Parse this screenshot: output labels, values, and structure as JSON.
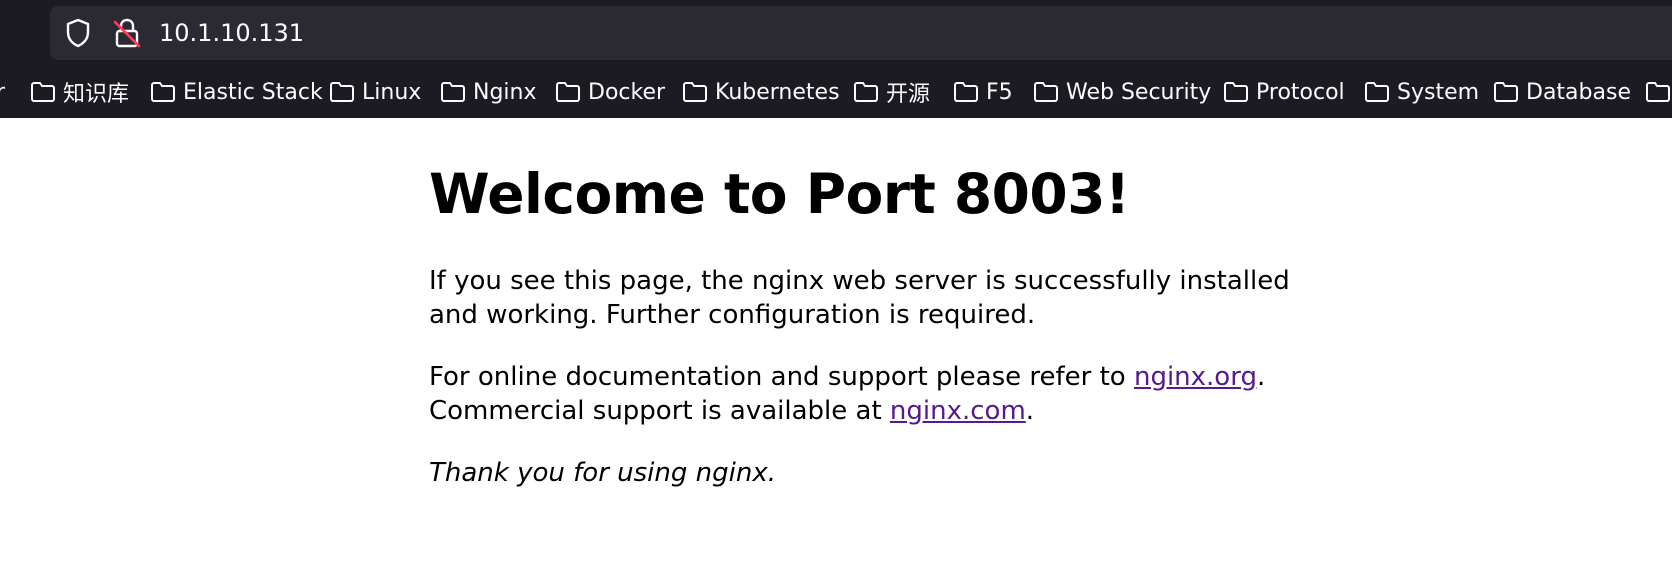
{
  "browser": {
    "url": "10.1.10.131",
    "bookmarks": [
      {
        "label": "r"
      },
      {
        "label": "知识库"
      },
      {
        "label": "Elastic Stack"
      },
      {
        "label": "Linux"
      },
      {
        "label": "Nginx"
      },
      {
        "label": "Docker"
      },
      {
        "label": "Kubernetes"
      },
      {
        "label": "开源"
      },
      {
        "label": "F5"
      },
      {
        "label": "Web Security"
      },
      {
        "label": "Protocol"
      },
      {
        "label": "System"
      },
      {
        "label": "Database"
      },
      {
        "label": ""
      }
    ]
  },
  "page": {
    "heading": "Welcome to Port 8003!",
    "para1": "If you see this page, the nginx web server is successfully installed and working. Further configuration is required.",
    "para2_prefix": "For online documentation and support please refer to ",
    "link_org": "nginx.org",
    "para2_mid": ".",
    "para2_line2_prefix": "Commercial support is available at ",
    "link_com": "nginx.com",
    "para2_suffix": ".",
    "thanks": "Thank you for using nginx."
  },
  "colors": {
    "chrome_bg": "#1c1b22",
    "urlbar_bg": "#2b2a33",
    "chrome_text": "#fbfbfe",
    "link_visited": "#551a8b"
  }
}
